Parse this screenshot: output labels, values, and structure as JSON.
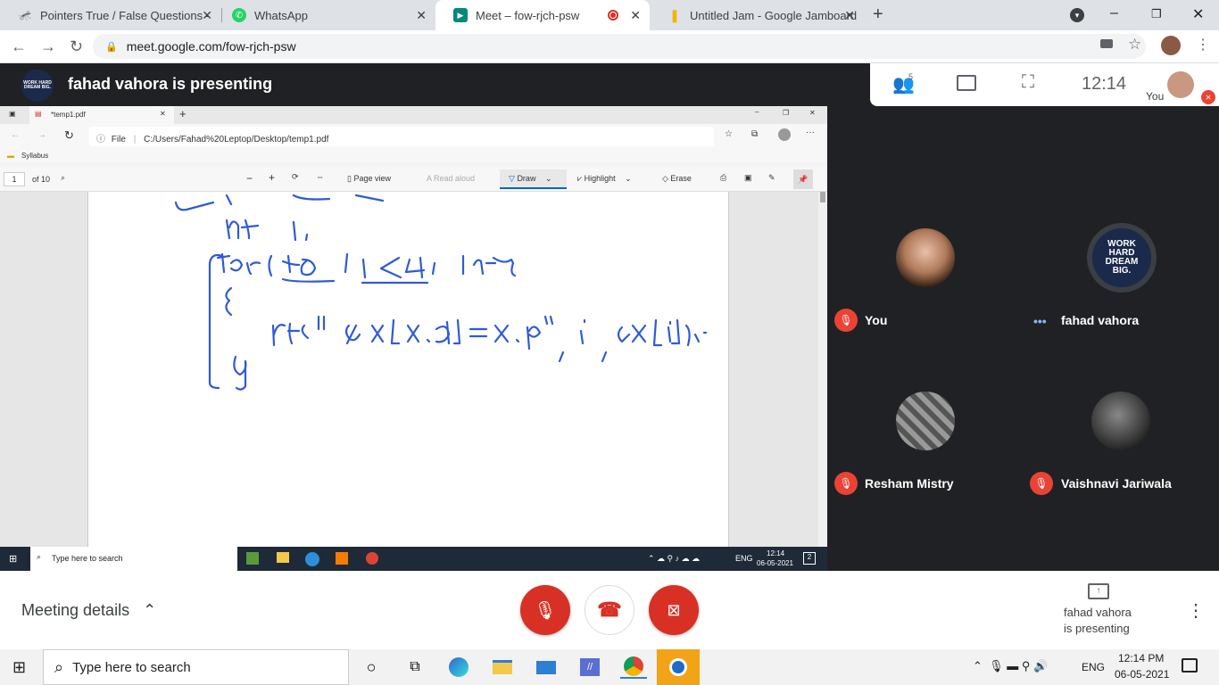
{
  "browser": {
    "tabs": [
      {
        "title": "Pointers True / False Questions -"
      },
      {
        "title": "WhatsApp"
      },
      {
        "title": "Meet – fow-rjch-psw"
      },
      {
        "title": "Untitled Jam - Google Jamboard"
      }
    ],
    "url": "meet.google.com/fow-rjch-psw"
  },
  "meet": {
    "presenting_banner": "fahad vahora is presenting",
    "logo_text": "WORK HARD DREAM BIG.",
    "people_count": "5",
    "time": "12:14",
    "you_label": "You",
    "participants": [
      {
        "name": "You",
        "mic": "muted"
      },
      {
        "name": "fahad vahora",
        "mic": "speaking"
      },
      {
        "name": "Resham Mistry",
        "mic": "muted"
      },
      {
        "name": "Vaishnavi Jariwala",
        "mic": "muted"
      }
    ],
    "meeting_details": "Meeting details",
    "presenting_status_line1": "fahad vahora",
    "presenting_status_line2": "is presenting"
  },
  "shared_screen": {
    "tab_title": "*temp1.pdf",
    "file_label": "File",
    "path": "C:/Users/Fahad%20Leptop/Desktop/temp1.pdf",
    "favorite": "Syllabus",
    "page_number": "1",
    "page_of": "of 10",
    "page_view": "Page view",
    "read_aloud": "Read aloud",
    "draw": "Draw",
    "highlight": "Highlight",
    "erase": "Erase",
    "search_placeholder": "Type here to search",
    "clock_time": "12:14",
    "clock_date": "06-05-2021",
    "lang": "ENG",
    "notif_count": "2"
  },
  "taskbar": {
    "search_placeholder": "Type here to search",
    "lang": "ENG",
    "time": "12:14 PM",
    "date": "06-05-2021"
  }
}
